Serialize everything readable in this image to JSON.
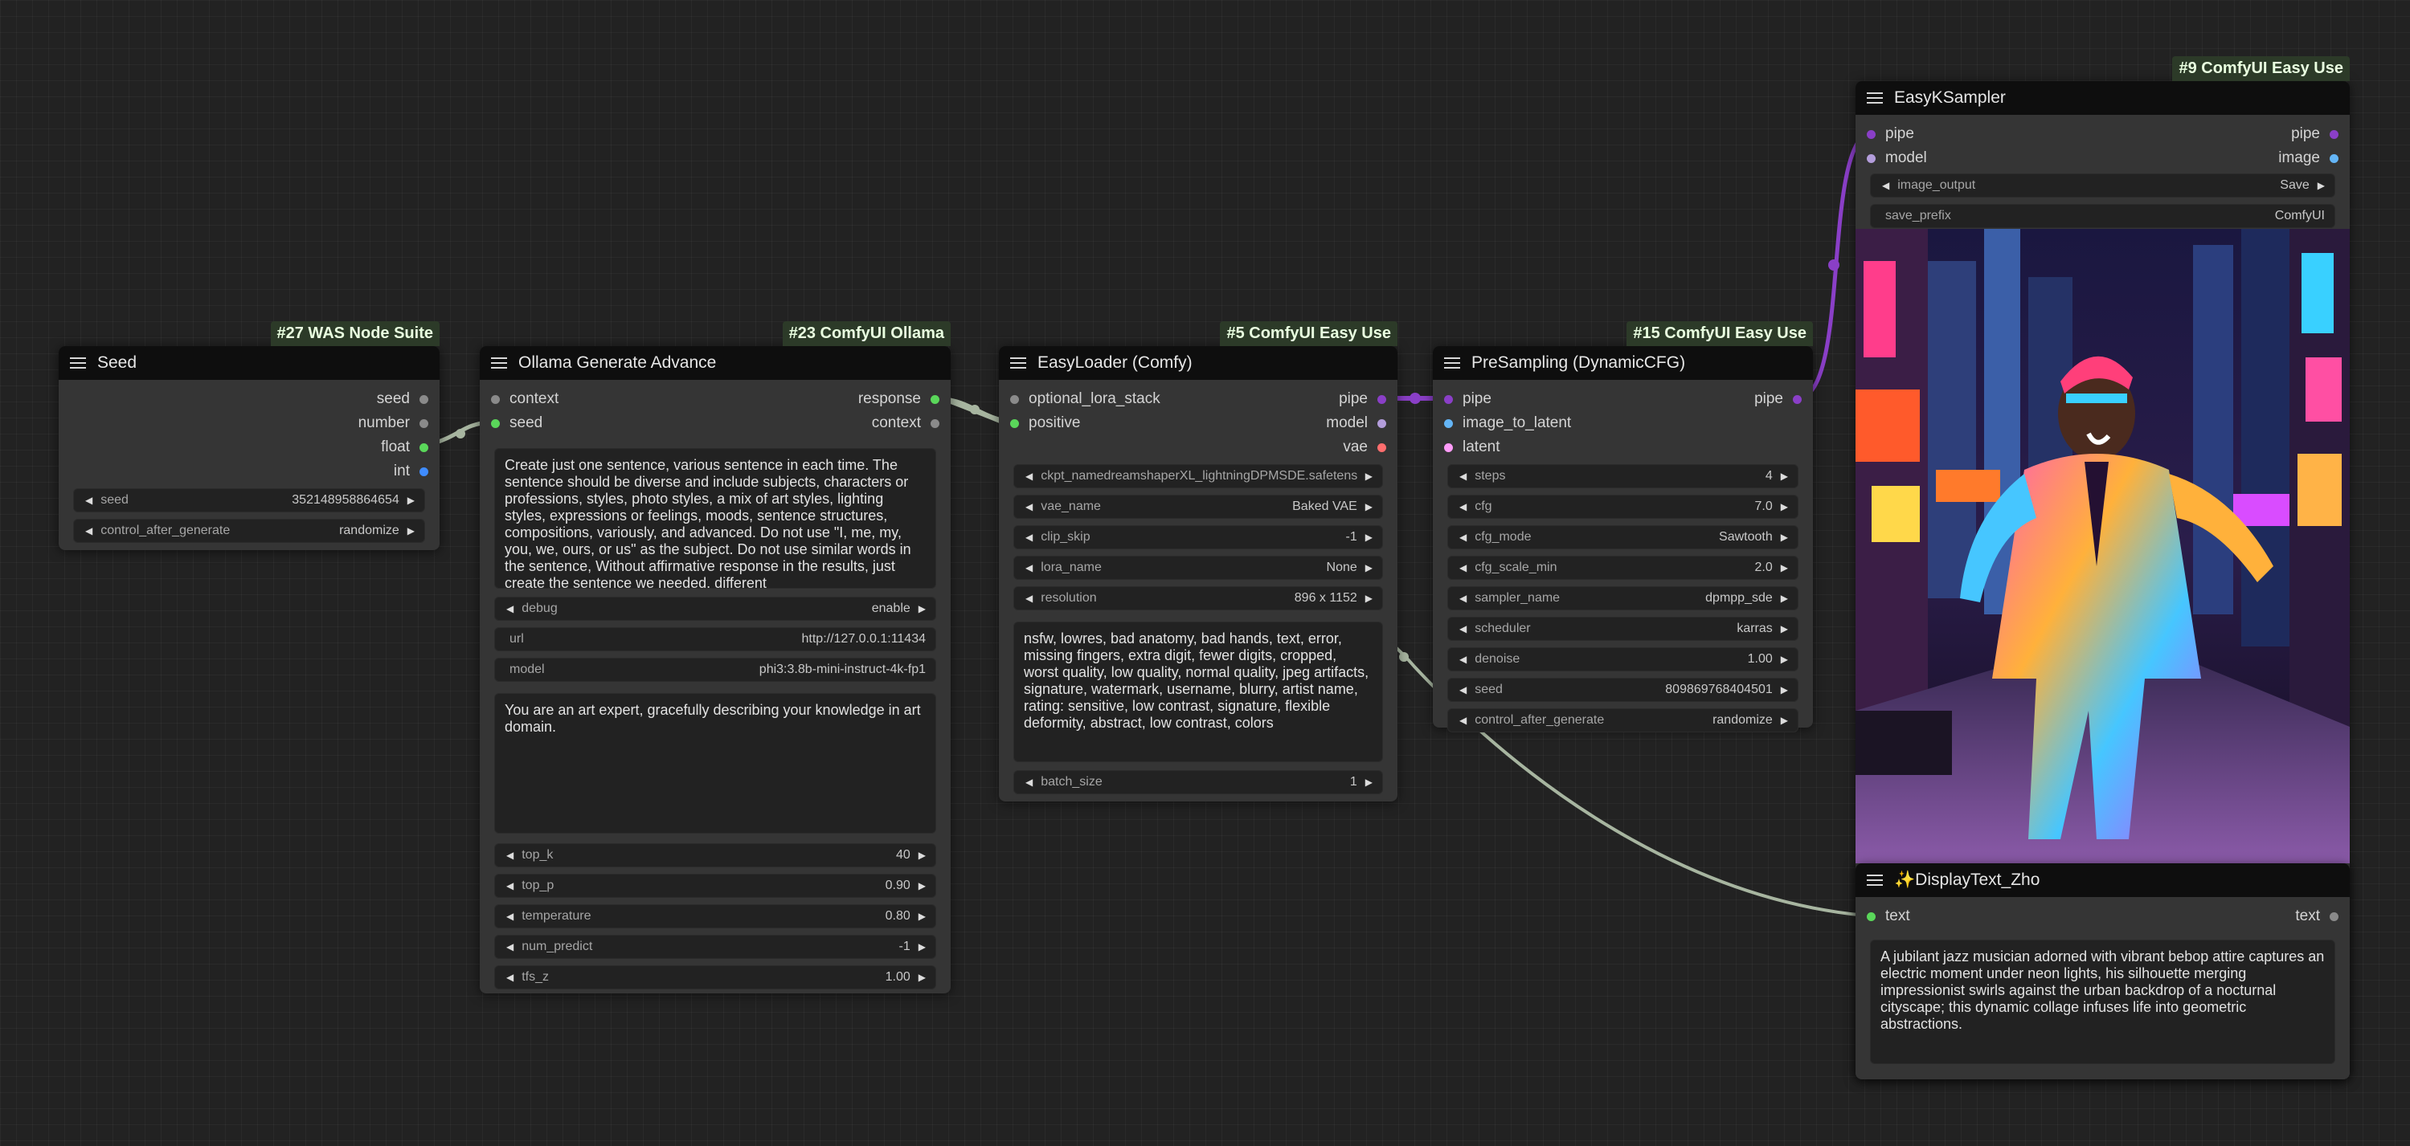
{
  "colors": {
    "background": "#222222",
    "node_body": "#353535",
    "node_header": "#0e0e0e",
    "badge_bg": "#2c3a28",
    "int_port": "#5ad75a",
    "pipe_port": "#8a3fc7",
    "model_port": "#b39ddb",
    "vae_port": "#ff6e6e",
    "latent_port": "#ff9cf9",
    "image_port": "#64b5f6",
    "wire_green": "#a7b5a0",
    "wire_purple": "#8a3fc7"
  },
  "seed_node": {
    "badge": "#27 WAS Node Suite",
    "title": "Seed",
    "outputs": [
      "seed",
      "number",
      "float",
      "int"
    ],
    "widgets": [
      {
        "label": "seed",
        "value": "352148958864654"
      },
      {
        "label": "control_after_generate",
        "value": "randomize"
      }
    ]
  },
  "ollama_node": {
    "badge": "#23 ComfyUI Ollama",
    "title": "Ollama Generate Advance",
    "inputs": [
      "context",
      "seed"
    ],
    "outputs": [
      "response",
      "context"
    ],
    "prompt": "Create just one sentence, various sentence in each time. The sentence should be diverse and include subjects, characters or professions, styles, photo styles, a mix of art styles, lighting styles, expressions or feelings, moods, sentence structures, compositions, variously, and advanced. Do not use \"I, me, my, you, we, ours, or us\" as the subject. Do not use similar words in the sentence, Without affirmative response in the results, just create the sentence we needed, different",
    "widgets": [
      {
        "label": "debug",
        "value": "enable"
      },
      {
        "label": "url",
        "value": "http://127.0.0.1:11434"
      },
      {
        "label": "model",
        "value": "phi3:3.8b-mini-instruct-4k-fp1"
      }
    ],
    "system": "You are an art expert, gracefully describing your knowledge in art domain.",
    "widgets2": [
      {
        "label": "top_k",
        "value": "40"
      },
      {
        "label": "top_p",
        "value": "0.90"
      },
      {
        "label": "temperature",
        "value": "0.80"
      },
      {
        "label": "num_predict",
        "value": "-1"
      },
      {
        "label": "tfs_z",
        "value": "1.00"
      }
    ]
  },
  "loader_node": {
    "badge": "#5 ComfyUI Easy Use",
    "title": "EasyLoader (Comfy)",
    "inputs": [
      "optional_lora_stack",
      "positive"
    ],
    "outputs": [
      "pipe",
      "model",
      "vae"
    ],
    "widgets": [
      {
        "label": "ckpt_namedreamshaperXL_lightningDPMSDE.safetensors",
        "value": ""
      },
      {
        "label": "vae_name",
        "value": "Baked VAE"
      },
      {
        "label": "clip_skip",
        "value": "-1"
      },
      {
        "label": "lora_name",
        "value": "None"
      },
      {
        "label": "resolution",
        "value": "896 x 1152"
      }
    ],
    "negative": "nsfw, lowres, bad anatomy, bad hands, text, error, missing fingers, extra digit, fewer digits, cropped, worst quality, low quality, normal quality, jpeg artifacts, signature, watermark, username, blurry, artist name, rating: sensitive, low contrast, signature, flexible deformity, abstract, low contrast, colors",
    "widgets2": [
      {
        "label": "batch_size",
        "value": "1"
      }
    ]
  },
  "presampling_node": {
    "badge": "#15 ComfyUI Easy Use",
    "title": "PreSampling (DynamicCFG)",
    "inputs": [
      "pipe",
      "image_to_latent",
      "latent"
    ],
    "outputs": [
      "pipe"
    ],
    "widgets": [
      {
        "label": "steps",
        "value": "4"
      },
      {
        "label": "cfg",
        "value": "7.0"
      },
      {
        "label": "cfg_mode",
        "value": "Sawtooth"
      },
      {
        "label": "cfg_scale_min",
        "value": "2.0"
      },
      {
        "label": "sampler_name",
        "value": "dpmpp_sde"
      },
      {
        "label": "scheduler",
        "value": "karras"
      },
      {
        "label": "denoise",
        "value": "1.00"
      },
      {
        "label": "seed",
        "value": "809869768404501"
      },
      {
        "label": "control_after_generate",
        "value": "randomize"
      }
    ]
  },
  "ksampler_node": {
    "badge": "#9 ComfyUI Easy Use",
    "title": "EasyKSampler",
    "inputs": [
      "pipe",
      "model"
    ],
    "outputs": [
      "pipe",
      "image"
    ],
    "widgets": [
      {
        "label": "image_output",
        "value": "Save"
      },
      {
        "label": "save_prefix",
        "value": "ComfyUI"
      }
    ]
  },
  "display_node": {
    "title": "✨DisplayText_Zho",
    "inputs": [
      "text"
    ],
    "outputs": [
      "text"
    ],
    "text": "A jubilant jazz musician adorned with vibrant bebop attire captures an electric moment under neon lights, his silhouette merging impressionist swirls against the urban backdrop of a nocturnal cityscape; this dynamic collage infuses life into geometric abstractions."
  }
}
